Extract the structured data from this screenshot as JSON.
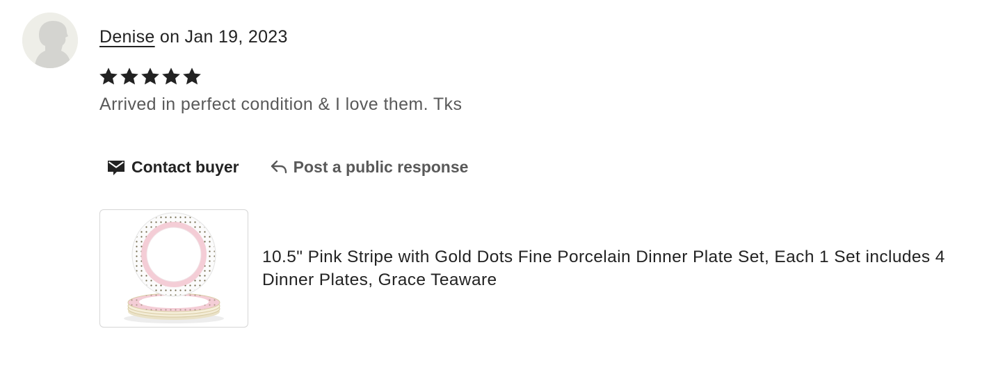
{
  "review": {
    "reviewer_name": "Denise",
    "date_text": " on Jan 19, 2023",
    "rating": 5,
    "rating_max": 5,
    "text": "Arrived in perfect condition & I love them. Tks"
  },
  "actions": {
    "contact_label": "Contact buyer",
    "respond_label": "Post a public response"
  },
  "listing": {
    "title": "10.5\" Pink Stripe with Gold Dots Fine Porcelain Dinner Plate Set, Each 1 Set includes 4 Dinner Plates, Grace Teaware"
  },
  "icons": {
    "avatar": "default-avatar-icon",
    "star": "star-icon",
    "contact": "envelope-icon",
    "respond": "reply-arrow-icon"
  },
  "colors": {
    "text_primary": "#222222",
    "text_secondary": "#595959",
    "avatar_bg": "#eeeee8",
    "plate_pink": "#f4cdd6"
  }
}
